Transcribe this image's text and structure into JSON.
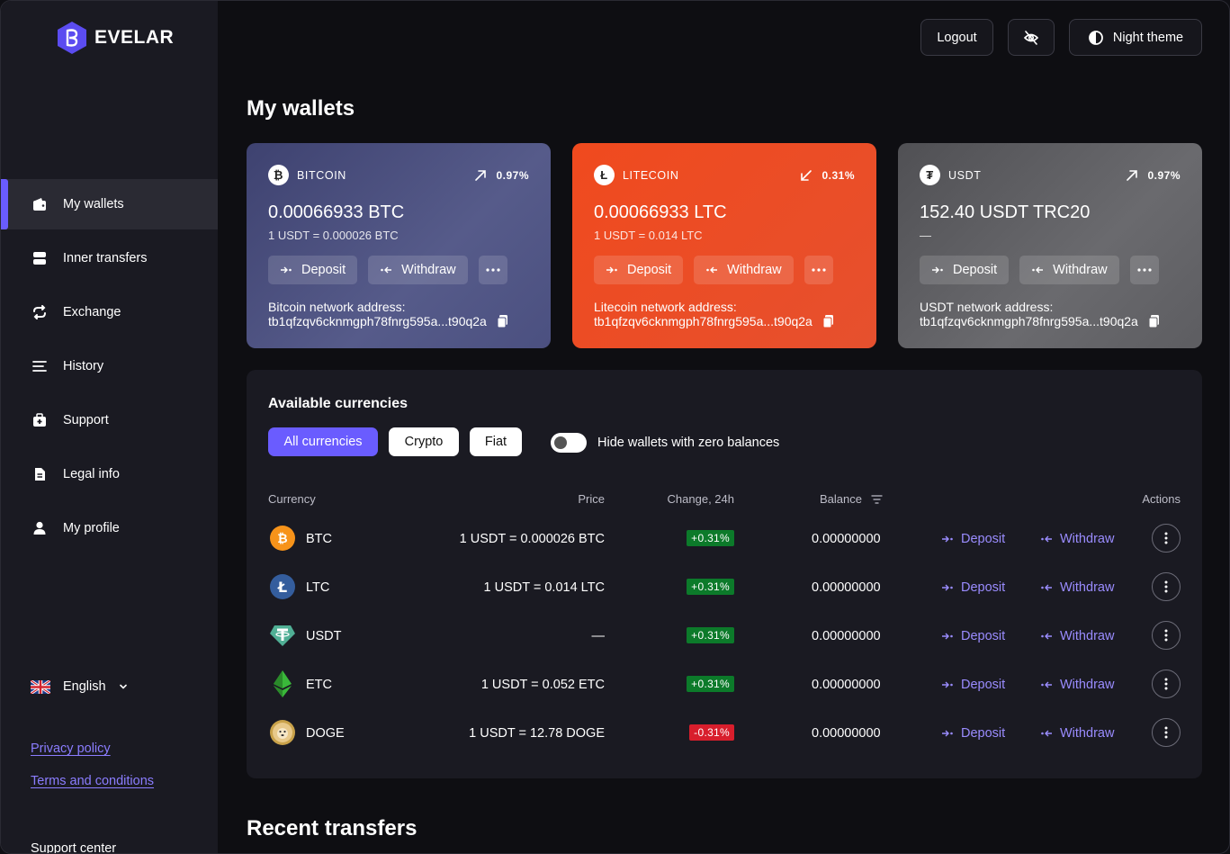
{
  "brand": {
    "name": "EVELAR",
    "accent": "#6a5cff"
  },
  "sidebar": {
    "items": [
      {
        "label": "My wallets",
        "icon": "wallet-icon",
        "active": true
      },
      {
        "label": "Inner transfers",
        "icon": "transfer-icon"
      },
      {
        "label": "Exchange",
        "icon": "exchange-icon"
      },
      {
        "label": "History",
        "icon": "history-icon"
      },
      {
        "label": "Support",
        "icon": "support-icon"
      },
      {
        "label": "Legal info",
        "icon": "document-icon"
      },
      {
        "label": "My profile",
        "icon": "user-icon"
      }
    ],
    "language": "English",
    "privacy": "Privacy policy",
    "terms": "Terms and conditions",
    "support_center": "Support center"
  },
  "topbar": {
    "logout": "Logout",
    "hide_balance_icon": "eye-off-icon",
    "theme": "Night theme"
  },
  "wallets_title": "My wallets",
  "wallets": [
    {
      "coin": "BITCOIN",
      "symbol": "₿",
      "trend": "up",
      "change": "0.97%",
      "amount": "0.00066933 BTC",
      "rate": "1 USDT = 0.000026 BTC",
      "deposit": "Deposit",
      "withdraw": "Withdraw",
      "addr_label": "Bitcoin network address:",
      "addr": "tb1qfzqv6cknmgph78fnrg595a...t90q2a",
      "color": "#4a4f7a"
    },
    {
      "coin": "LITECOIN",
      "symbol": "Ł",
      "trend": "down",
      "change": "0.31%",
      "amount": "0.00066933 LTC",
      "rate": "1 USDT = 0.014 LTC",
      "deposit": "Deposit",
      "withdraw": "Withdraw",
      "addr_label": "Litecoin network address:",
      "addr": "tb1qfzqv6cknmgph78fnrg595a...t90q2a",
      "color": "#ee4a24"
    },
    {
      "coin": "USDT",
      "symbol": "₮",
      "trend": "up",
      "change": "0.97%",
      "amount": "152.40 USDT TRC20",
      "rate": "—",
      "deposit": "Deposit",
      "withdraw": "Withdraw",
      "addr_label": "USDT network address:",
      "addr": "tb1qfzqv6cknmgph78fnrg595a...t90q2a",
      "color": "#5e5e62"
    }
  ],
  "currencies": {
    "title": "Available currencies",
    "filters": [
      "All currencies",
      "Crypto",
      "Fiat"
    ],
    "hide_zero": "Hide wallets with zero balances",
    "headers": {
      "currency": "Currency",
      "price": "Price",
      "change": "Change, 24h",
      "balance": "Balance",
      "actions": "Actions"
    },
    "rows": [
      {
        "code": "BTC",
        "price": "1 USDT = 0.000026 BTC",
        "change": "+0.31%",
        "positive": true,
        "balance": "0.00000000",
        "deposit": "Deposit",
        "withdraw": "Withdraw"
      },
      {
        "code": "LTC",
        "price": "1 USDT = 0.014 LTC",
        "change": "+0.31%",
        "positive": true,
        "balance": "0.00000000",
        "deposit": "Deposit",
        "withdraw": "Withdraw"
      },
      {
        "code": "USDT",
        "price": "—",
        "change": "+0.31%",
        "positive": true,
        "balance": "0.00000000",
        "deposit": "Deposit",
        "withdraw": "Withdraw"
      },
      {
        "code": "ETC",
        "price": "1 USDT = 0.052 ETC",
        "change": "+0.31%",
        "positive": true,
        "balance": "0.00000000",
        "deposit": "Deposit",
        "withdraw": "Withdraw"
      },
      {
        "code": "DOGE",
        "price": "1 USDT = 12.78 DOGE",
        "change": "-0.31%",
        "positive": false,
        "balance": "0.00000000",
        "deposit": "Deposit",
        "withdraw": "Withdraw"
      }
    ]
  },
  "recent_title": "Recent transfers"
}
